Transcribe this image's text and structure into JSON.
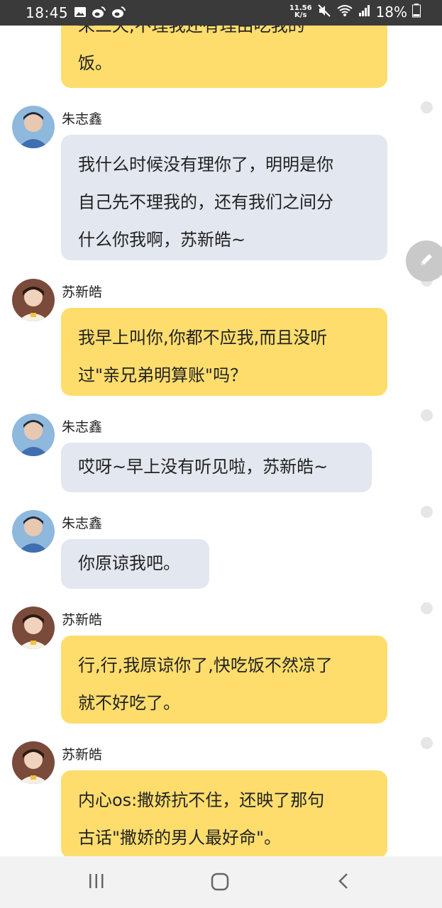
{
  "status_bar": {
    "time": "18:45",
    "net_speed_value": "11.56",
    "net_speed_unit": "K/s",
    "battery": "18%",
    "left_icons": [
      "image-icon",
      "weibo-icon",
      "weibo-icon"
    ],
    "right_icons": [
      "mute-icon",
      "wifi-icon",
      "signal-icon",
      "battery-icon"
    ]
  },
  "messages": [
    {
      "sender": "",
      "bubble": "yellow",
      "lines": [
        "来三天,不理我还有理由吃我的",
        "饭。"
      ]
    },
    {
      "sender": "朱志鑫",
      "bubble": "gray",
      "lines": [
        "我什么时候没有理你了，明明是你",
        "自己先不理我的，还有我们之间分",
        "什么你我啊，苏新皓~"
      ]
    },
    {
      "sender": "苏新皓",
      "bubble": "yellow",
      "lines": [
        "我早上叫你,你都不应我,而且没听",
        "过\"亲兄弟明算账\"吗？"
      ]
    },
    {
      "sender": "朱志鑫",
      "bubble": "gray",
      "lines": [
        "哎呀~早上没有听见啦，苏新皓~"
      ]
    },
    {
      "sender": "朱志鑫",
      "bubble": "gray",
      "lines": [
        "你原谅我吧。"
      ]
    },
    {
      "sender": "苏新皓",
      "bubble": "yellow",
      "lines": [
        "行,行,我原谅你了,快吃饭不然凉了",
        "就不好吃了。"
      ]
    },
    {
      "sender": "苏新皓",
      "bubble": "yellow",
      "lines": [
        "内心os:撒娇抗不住，还映了那句",
        "古话\"撒娇的男人最好命\"。"
      ]
    }
  ],
  "colors": {
    "yellow_bubble": "#fedd6d",
    "gray_bubble": "#e3e7ef"
  },
  "nav": {
    "icons": [
      "recent-apps-icon",
      "home-icon",
      "back-icon"
    ]
  }
}
